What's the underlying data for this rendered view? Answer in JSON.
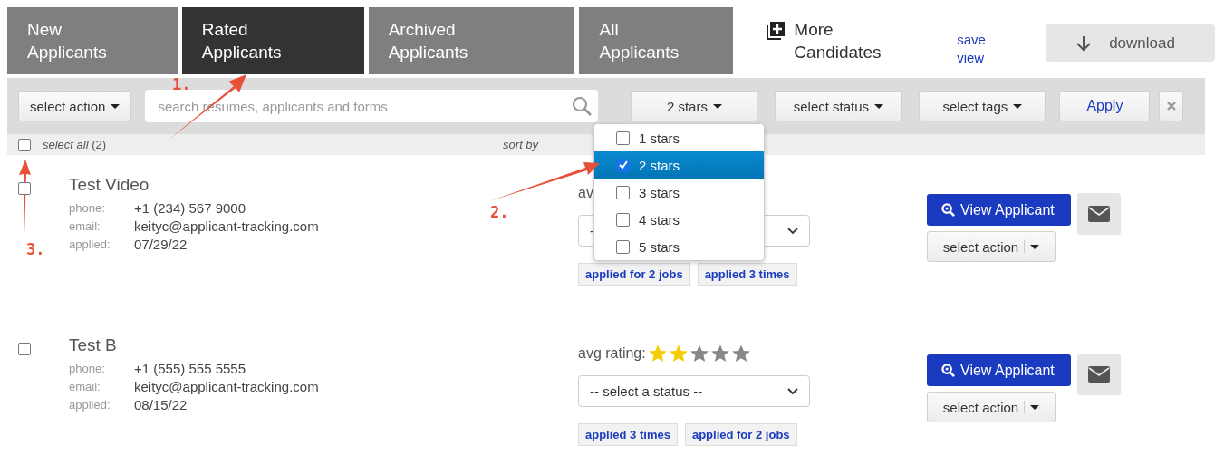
{
  "tabs": [
    {
      "label": "New Applicants",
      "selected": false
    },
    {
      "label": "Rated Applicants",
      "selected": true
    },
    {
      "label": "Archived Applicants",
      "selected": false
    },
    {
      "label": "All Applicants",
      "selected": false
    }
  ],
  "more_candidates": "More Candidates",
  "save_view": "save view",
  "download": "download",
  "toolbar": {
    "select_action": "select action",
    "search_placeholder": "search resumes, applicants and forms",
    "rating_filter": "2 stars",
    "status_filter": "select status",
    "tags_filter": "select tags",
    "apply": "Apply"
  },
  "subbar": {
    "select_all": "select all",
    "count": "(2)",
    "select_all_checked": false,
    "sort_by": "sort by"
  },
  "rating_menu": [
    {
      "label": "1 stars",
      "checked": false,
      "selected": false
    },
    {
      "label": "2 stars",
      "checked": true,
      "selected": true
    },
    {
      "label": "3 stars",
      "checked": false,
      "selected": false
    },
    {
      "label": "4 stars",
      "checked": false,
      "selected": false
    },
    {
      "label": "5 stars",
      "checked": false,
      "selected": false
    }
  ],
  "applicants": [
    {
      "name": "Test Video",
      "checked": false,
      "fields": [
        {
          "label": "phone:",
          "value": "+1 (234) 567 9000"
        },
        {
          "label": "email:",
          "value": "keityc@applicant-tracking.com"
        },
        {
          "label": "applied:",
          "value": "07/29/22"
        }
      ],
      "rating_label": "av",
      "status": "-",
      "tags": [
        "applied for 2 jobs",
        "applied 3 times"
      ],
      "view": "View Applicant",
      "action": "select action"
    },
    {
      "name": "Test B",
      "checked": false,
      "fields": [
        {
          "label": "phone:",
          "value": "+1 (555) 555 5555"
        },
        {
          "label": "email:",
          "value": "keityc@applicant-tracking.com"
        },
        {
          "label": "applied:",
          "value": "08/15/22"
        }
      ],
      "rating_label": "avg rating:",
      "stars": 2,
      "status": "-- select a status --",
      "tags": [
        "applied 3 times",
        "applied for 2 jobs"
      ],
      "view": "View Applicant",
      "action": "select action"
    }
  ],
  "annotations": [
    "1.",
    "2.",
    "3."
  ]
}
